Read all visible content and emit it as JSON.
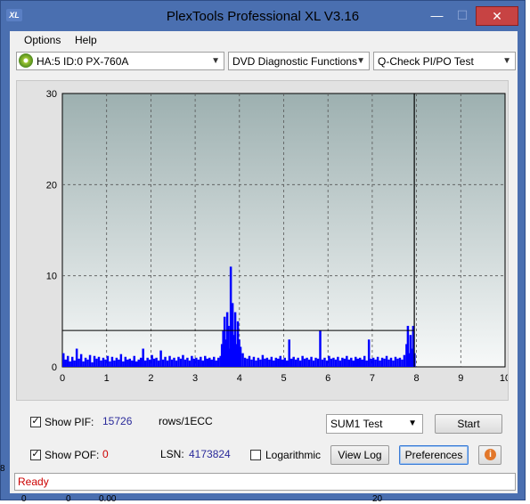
{
  "window": {
    "title": "PlexTools Professional XL V3.16",
    "app_icon": "XL",
    "min_icon": "—",
    "max_icon": "☐",
    "close_icon": "✕"
  },
  "menu": {
    "options": "Options",
    "help": "Help"
  },
  "toolbar": {
    "drive": "HA:5 ID:0  PX-760A",
    "function": "DVD Diagnostic Functions",
    "test": "Q-Check PI/PO Test"
  },
  "chart_data": {
    "type": "bar",
    "xlim": [
      0,
      10
    ],
    "ylim": [
      0,
      30
    ],
    "x_ticks": [
      "0",
      "1",
      "2",
      "3",
      "4",
      "5",
      "6",
      "7",
      "8",
      "9",
      "10"
    ],
    "y_ticks": [
      "0",
      "10",
      "20",
      "30"
    ],
    "grid": true,
    "threshold_line": 4,
    "end_marker_x": 7.95,
    "series": [
      {
        "color": "#0000ff",
        "values": [
          [
            0.0,
            1.5
          ],
          [
            0.05,
            0.8
          ],
          [
            0.1,
            1.2
          ],
          [
            0.15,
            0.6
          ],
          [
            0.2,
            1.1
          ],
          [
            0.25,
            0.7
          ],
          [
            0.3,
            2.0
          ],
          [
            0.35,
            0.9
          ],
          [
            0.4,
            1.4
          ],
          [
            0.45,
            0.6
          ],
          [
            0.5,
            1.0
          ],
          [
            0.55,
            0.8
          ],
          [
            0.6,
            1.3
          ],
          [
            0.65,
            0.5
          ],
          [
            0.7,
            1.2
          ],
          [
            0.75,
            0.9
          ],
          [
            0.8,
            1.1
          ],
          [
            0.85,
            0.7
          ],
          [
            0.9,
            1.0
          ],
          [
            0.95,
            0.8
          ],
          [
            1.0,
            1.2
          ],
          [
            1.05,
            0.6
          ],
          [
            1.1,
            1.1
          ],
          [
            1.15,
            0.7
          ],
          [
            1.2,
            1.0
          ],
          [
            1.25,
            0.8
          ],
          [
            1.3,
            1.4
          ],
          [
            1.35,
            0.6
          ],
          [
            1.4,
            1.1
          ],
          [
            1.45,
            0.8
          ],
          [
            1.5,
            0.9
          ],
          [
            1.55,
            0.7
          ],
          [
            1.6,
            1.2
          ],
          [
            1.65,
            0.6
          ],
          [
            1.7,
            0.8
          ],
          [
            1.75,
            1.0
          ],
          [
            1.8,
            2.0
          ],
          [
            1.85,
            0.7
          ],
          [
            1.9,
            1.0
          ],
          [
            1.95,
            0.8
          ],
          [
            2.0,
            1.3
          ],
          [
            2.05,
            0.9
          ],
          [
            2.1,
            1.0
          ],
          [
            2.15,
            0.7
          ],
          [
            2.2,
            1.8
          ],
          [
            2.25,
            0.8
          ],
          [
            2.3,
            1.1
          ],
          [
            2.35,
            0.7
          ],
          [
            2.4,
            1.2
          ],
          [
            2.45,
            0.8
          ],
          [
            2.5,
            1.0
          ],
          [
            2.55,
            0.7
          ],
          [
            2.6,
            1.1
          ],
          [
            2.65,
            0.9
          ],
          [
            2.7,
            1.3
          ],
          [
            2.75,
            0.8
          ],
          [
            2.8,
            1.0
          ],
          [
            2.85,
            0.7
          ],
          [
            2.9,
            1.2
          ],
          [
            2.95,
            0.9
          ],
          [
            3.0,
            1.0
          ],
          [
            3.05,
            0.8
          ],
          [
            3.1,
            1.1
          ],
          [
            3.15,
            0.7
          ],
          [
            3.2,
            1.2
          ],
          [
            3.25,
            0.9
          ],
          [
            3.3,
            1.0
          ],
          [
            3.35,
            0.8
          ],
          [
            3.4,
            1.1
          ],
          [
            3.45,
            0.7
          ],
          [
            3.5,
            1.0
          ],
          [
            3.55,
            1.2
          ],
          [
            3.58,
            2.5
          ],
          [
            3.61,
            4.0
          ],
          [
            3.64,
            5.5
          ],
          [
            3.67,
            3.0
          ],
          [
            3.7,
            6.0
          ],
          [
            3.73,
            4.5
          ],
          [
            3.76,
            2.0
          ],
          [
            3.78,
            11.0
          ],
          [
            3.8,
            5.0
          ],
          [
            3.82,
            7.0
          ],
          [
            3.85,
            3.5
          ],
          [
            3.88,
            6.0
          ],
          [
            3.91,
            2.5
          ],
          [
            3.94,
            5.0
          ],
          [
            3.97,
            3.0
          ],
          [
            4.0,
            2.2
          ],
          [
            4.05,
            1.5
          ],
          [
            4.1,
            1.0
          ],
          [
            4.15,
            0.9
          ],
          [
            4.2,
            1.2
          ],
          [
            4.25,
            0.8
          ],
          [
            4.3,
            1.1
          ],
          [
            4.35,
            0.7
          ],
          [
            4.4,
            1.0
          ],
          [
            4.45,
            0.8
          ],
          [
            4.5,
            1.3
          ],
          [
            4.55,
            0.9
          ],
          [
            4.6,
            1.0
          ],
          [
            4.65,
            0.8
          ],
          [
            4.7,
            1.1
          ],
          [
            4.75,
            0.7
          ],
          [
            4.8,
            1.0
          ],
          [
            4.85,
            0.9
          ],
          [
            4.9,
            1.2
          ],
          [
            4.95,
            0.8
          ],
          [
            5.0,
            1.0
          ],
          [
            5.05,
            0.7
          ],
          [
            5.1,
            3.0
          ],
          [
            5.15,
            0.9
          ],
          [
            5.2,
            1.1
          ],
          [
            5.25,
            0.8
          ],
          [
            5.3,
            1.0
          ],
          [
            5.35,
            0.7
          ],
          [
            5.4,
            1.2
          ],
          [
            5.45,
            0.9
          ],
          [
            5.5,
            1.0
          ],
          [
            5.55,
            0.8
          ],
          [
            5.6,
            1.1
          ],
          [
            5.65,
            0.7
          ],
          [
            5.7,
            1.0
          ],
          [
            5.75,
            0.9
          ],
          [
            5.8,
            4.0
          ],
          [
            5.85,
            0.8
          ],
          [
            5.9,
            1.0
          ],
          [
            5.95,
            0.7
          ],
          [
            6.0,
            1.2
          ],
          [
            6.05,
            0.9
          ],
          [
            6.1,
            1.0
          ],
          [
            6.15,
            0.8
          ],
          [
            6.2,
            1.1
          ],
          [
            6.25,
            0.7
          ],
          [
            6.3,
            1.0
          ],
          [
            6.35,
            0.9
          ],
          [
            6.4,
            1.2
          ],
          [
            6.45,
            0.8
          ],
          [
            6.5,
            1.0
          ],
          [
            6.55,
            0.7
          ],
          [
            6.6,
            1.1
          ],
          [
            6.65,
            0.9
          ],
          [
            6.7,
            1.0
          ],
          [
            6.75,
            0.8
          ],
          [
            6.8,
            1.2
          ],
          [
            6.85,
            0.7
          ],
          [
            6.9,
            3.0
          ],
          [
            6.95,
            0.9
          ],
          [
            7.0,
            1.0
          ],
          [
            7.05,
            0.8
          ],
          [
            7.1,
            1.1
          ],
          [
            7.15,
            0.7
          ],
          [
            7.2,
            1.0
          ],
          [
            7.25,
            0.9
          ],
          [
            7.3,
            1.2
          ],
          [
            7.35,
            0.8
          ],
          [
            7.4,
            1.0
          ],
          [
            7.45,
            0.7
          ],
          [
            7.5,
            1.1
          ],
          [
            7.55,
            0.9
          ],
          [
            7.6,
            1.0
          ],
          [
            7.65,
            0.8
          ],
          [
            7.7,
            1.3
          ],
          [
            7.75,
            2.5
          ],
          [
            7.78,
            4.5
          ],
          [
            7.81,
            1.5
          ],
          [
            7.84,
            3.5
          ],
          [
            7.87,
            2.0
          ],
          [
            7.9,
            4.5
          ],
          [
            7.93,
            1.5
          ]
        ]
      }
    ]
  },
  "controls": {
    "show_pif_label": "Show PIF:",
    "pif_value": "15726",
    "pif_unit": "rows/1ECC",
    "show_pof_label": "Show POF:",
    "pof_value": "0",
    "lsn_label": "LSN:",
    "lsn_value": "4173824",
    "logarithmic_label": "Logarithmic",
    "sum_test": "SUM1 Test",
    "start_label": "Start",
    "view_log_label": "View Log",
    "preferences_label": "Preferences",
    "check_mark": "✓",
    "info_glyph": "i"
  },
  "status": {
    "text": "Ready"
  },
  "background": {
    "left_fragment": "8",
    "bottom_left_a": "0",
    "bottom_left_b": "0",
    "bottom_left_c": "0.00",
    "bottom_right": "20"
  }
}
